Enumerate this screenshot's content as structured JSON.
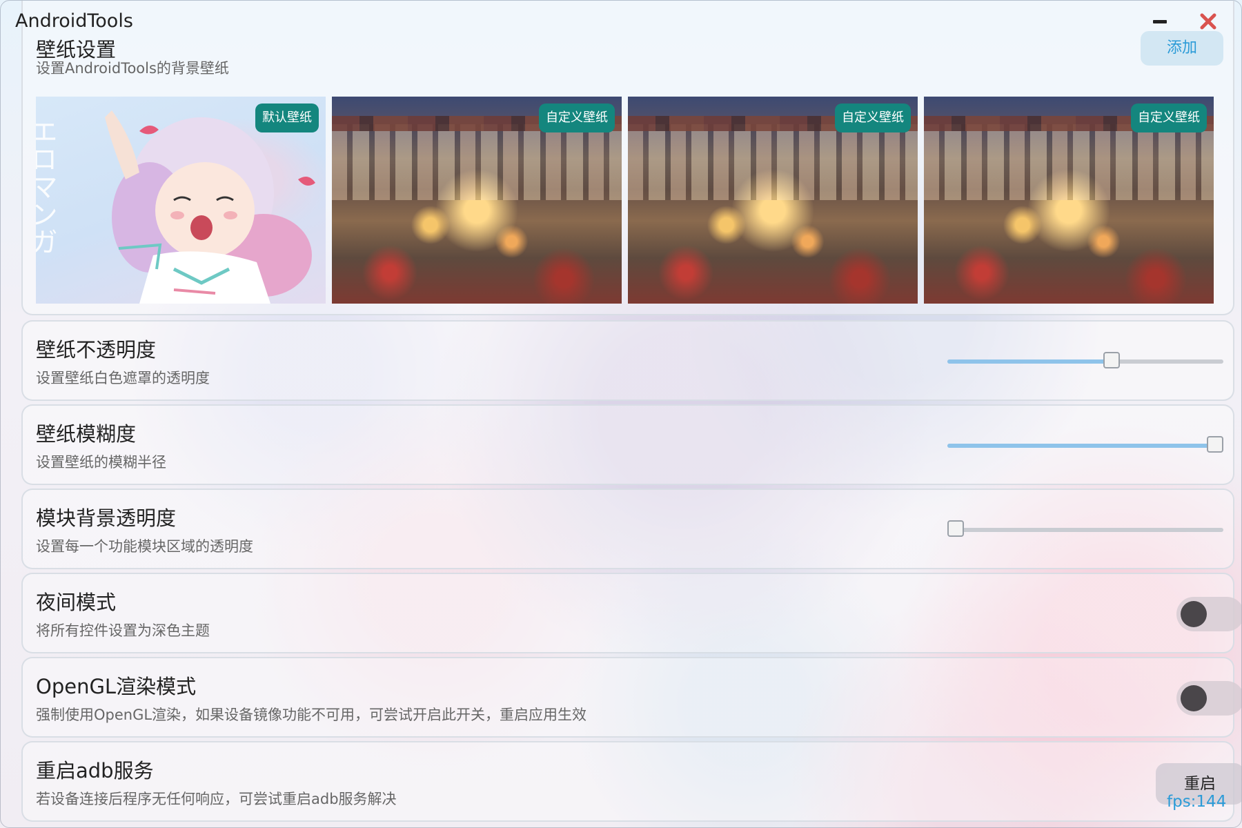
{
  "window": {
    "title": "AndroidTools",
    "minimize_icon": "minimize-icon",
    "close_icon": "close-icon",
    "close_color": "#d9534f"
  },
  "wallpaper_settings": {
    "title": "壁纸设置",
    "description": "设置AndroidTools的背景壁纸",
    "add_label": "添加",
    "wallpapers": [
      {
        "badge": "默认壁纸",
        "art_text": "エロマンガ"
      },
      {
        "badge": "自定义壁纸"
      },
      {
        "badge": "自定义壁纸"
      },
      {
        "badge": "自定义壁纸"
      }
    ]
  },
  "wallpaper_opacity": {
    "title": "壁纸不透明度",
    "description": "设置壁纸白色遮罩的透明度",
    "value_fraction": 0.6
  },
  "wallpaper_blur": {
    "title": "壁纸模糊度",
    "description": "设置壁纸的模糊半径",
    "value_fraction": 1.0
  },
  "module_bg_opacity": {
    "title": "模块背景透明度",
    "description": "设置每一个功能模块区域的透明度",
    "value_fraction": 0.0
  },
  "night_mode": {
    "title": "夜间模式",
    "description": "将所有控件设置为深色主题",
    "enabled": false
  },
  "opengl_mode": {
    "title": "OpenGL渲染模式",
    "description": "强制使用OpenGL渲染，如果设备镜像功能不可用，可尝试开启此开关，重启应用生效",
    "enabled": false
  },
  "restart_adb": {
    "title": "重启adb服务",
    "description": "若设备连接后程序无任何响应，可尝试重启adb服务解决",
    "button_label": "重启"
  },
  "status": {
    "fps": "fps:144"
  },
  "colors": {
    "accent": "#2b9bd7",
    "badge": "#14867e",
    "slider_fill": "#8ec3ea"
  }
}
